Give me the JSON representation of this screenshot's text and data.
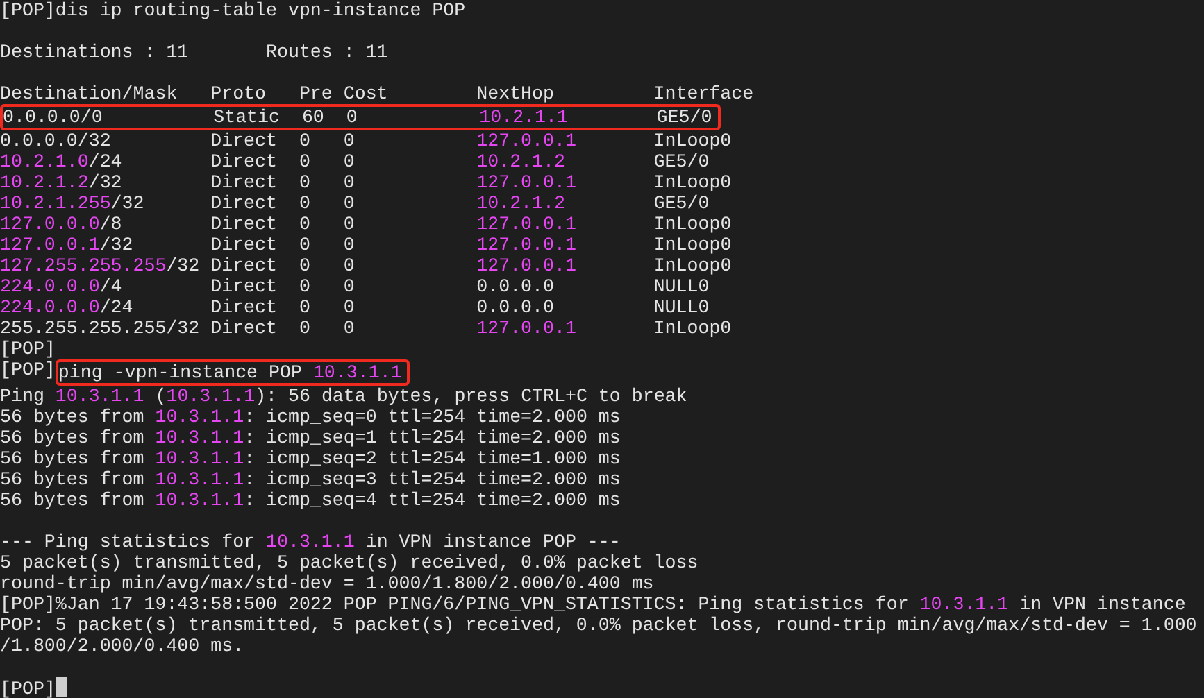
{
  "terminal": {
    "lines": [
      {
        "kind": "text",
        "parts": [
          {
            "kind": "plain",
            "text": "[POP]dis ip routing-table vpn-instance POP"
          }
        ]
      },
      {
        "kind": "blank"
      },
      {
        "kind": "text",
        "parts": [
          {
            "kind": "plain",
            "text": "Destinations : 11       Routes : 11"
          }
        ]
      },
      {
        "kind": "blank"
      },
      {
        "kind": "text",
        "parts": [
          {
            "kind": "plain",
            "text": "Destination/Mask   Proto   Pre Cost        NextHop         Interface"
          }
        ]
      },
      {
        "kind": "text",
        "parts": [
          {
            "kind": "highlight",
            "parts": [
              {
                "kind": "plain",
                "text": "0.0.0.0/0          Static  60  0           "
              },
              {
                "kind": "address",
                "text": "10.2.1.1"
              },
              {
                "kind": "plain",
                "text": "        GE5/0"
              }
            ]
          }
        ]
      },
      {
        "kind": "text",
        "parts": [
          {
            "kind": "plain",
            "text": "0.0.0.0/32         Direct  0   0           "
          },
          {
            "kind": "address",
            "text": "127.0.0.1"
          },
          {
            "kind": "plain",
            "text": "       InLoop0"
          }
        ]
      },
      {
        "kind": "text",
        "parts": [
          {
            "kind": "address",
            "text": "10.2.1.0"
          },
          {
            "kind": "plain",
            "text": "/24        Direct  0   0           "
          },
          {
            "kind": "address",
            "text": "10.2.1.2"
          },
          {
            "kind": "plain",
            "text": "        GE5/0"
          }
        ]
      },
      {
        "kind": "text",
        "parts": [
          {
            "kind": "address",
            "text": "10.2.1.2"
          },
          {
            "kind": "plain",
            "text": "/32        Direct  0   0           "
          },
          {
            "kind": "address",
            "text": "127.0.0.1"
          },
          {
            "kind": "plain",
            "text": "       InLoop0"
          }
        ]
      },
      {
        "kind": "text",
        "parts": [
          {
            "kind": "address",
            "text": "10.2.1.255"
          },
          {
            "kind": "plain",
            "text": "/32      Direct  0   0           "
          },
          {
            "kind": "address",
            "text": "10.2.1.2"
          },
          {
            "kind": "plain",
            "text": "        GE5/0"
          }
        ]
      },
      {
        "kind": "text",
        "parts": [
          {
            "kind": "address",
            "text": "127.0.0.0"
          },
          {
            "kind": "plain",
            "text": "/8        Direct  0   0           "
          },
          {
            "kind": "address",
            "text": "127.0.0.1"
          },
          {
            "kind": "plain",
            "text": "       InLoop0"
          }
        ]
      },
      {
        "kind": "text",
        "parts": [
          {
            "kind": "address",
            "text": "127.0.0.1"
          },
          {
            "kind": "plain",
            "text": "/32       Direct  0   0           "
          },
          {
            "kind": "address",
            "text": "127.0.0.1"
          },
          {
            "kind": "plain",
            "text": "       InLoop0"
          }
        ]
      },
      {
        "kind": "text",
        "parts": [
          {
            "kind": "address",
            "text": "127.255.255.255"
          },
          {
            "kind": "plain",
            "text": "/32 Direct  0   0           "
          },
          {
            "kind": "address",
            "text": "127.0.0.1"
          },
          {
            "kind": "plain",
            "text": "       InLoop0"
          }
        ]
      },
      {
        "kind": "text",
        "parts": [
          {
            "kind": "address",
            "text": "224.0.0.0"
          },
          {
            "kind": "plain",
            "text": "/4        Direct  0   0           0.0.0.0         NULL0"
          }
        ]
      },
      {
        "kind": "text",
        "parts": [
          {
            "kind": "address",
            "text": "224.0.0.0"
          },
          {
            "kind": "plain",
            "text": "/24       Direct  0   0           0.0.0.0         NULL0"
          }
        ]
      },
      {
        "kind": "text",
        "parts": [
          {
            "kind": "plain",
            "text": "255.255.255.255/32 Direct  0   0           "
          },
          {
            "kind": "address",
            "text": "127.0.0.1"
          },
          {
            "kind": "plain",
            "text": "       InLoop0"
          }
        ]
      },
      {
        "kind": "text",
        "parts": [
          {
            "kind": "plain",
            "text": "[POP]"
          }
        ]
      },
      {
        "kind": "text",
        "parts": [
          {
            "kind": "plain",
            "text": "[POP]"
          },
          {
            "kind": "highlight",
            "parts": [
              {
                "kind": "plain",
                "text": "ping -vpn-instance POP "
              },
              {
                "kind": "address",
                "text": "10.3.1.1"
              }
            ]
          }
        ]
      },
      {
        "kind": "text",
        "parts": [
          {
            "kind": "plain",
            "text": "Ping "
          },
          {
            "kind": "address",
            "text": "10.3.1.1"
          },
          {
            "kind": "plain",
            "text": " ("
          },
          {
            "kind": "address",
            "text": "10.3.1.1"
          },
          {
            "kind": "plain",
            "text": "): 56 data bytes, press CTRL+C to break"
          }
        ]
      },
      {
        "kind": "text",
        "parts": [
          {
            "kind": "plain",
            "text": "56 bytes from "
          },
          {
            "kind": "address",
            "text": "10.3.1.1"
          },
          {
            "kind": "plain",
            "text": ": icmp_seq=0 ttl=254 time=2.000 ms"
          }
        ]
      },
      {
        "kind": "text",
        "parts": [
          {
            "kind": "plain",
            "text": "56 bytes from "
          },
          {
            "kind": "address",
            "text": "10.3.1.1"
          },
          {
            "kind": "plain",
            "text": ": icmp_seq=1 ttl=254 time=2.000 ms"
          }
        ]
      },
      {
        "kind": "text",
        "parts": [
          {
            "kind": "plain",
            "text": "56 bytes from "
          },
          {
            "kind": "address",
            "text": "10.3.1.1"
          },
          {
            "kind": "plain",
            "text": ": icmp_seq=2 ttl=254 time=1.000 ms"
          }
        ]
      },
      {
        "kind": "text",
        "parts": [
          {
            "kind": "plain",
            "text": "56 bytes from "
          },
          {
            "kind": "address",
            "text": "10.3.1.1"
          },
          {
            "kind": "plain",
            "text": ": icmp_seq=3 ttl=254 time=2.000 ms"
          }
        ]
      },
      {
        "kind": "text",
        "parts": [
          {
            "kind": "plain",
            "text": "56 bytes from "
          },
          {
            "kind": "address",
            "text": "10.3.1.1"
          },
          {
            "kind": "plain",
            "text": ": icmp_seq=4 ttl=254 time=2.000 ms"
          }
        ]
      },
      {
        "kind": "blank"
      },
      {
        "kind": "text",
        "parts": [
          {
            "kind": "plain",
            "text": "--- Ping statistics for "
          },
          {
            "kind": "address",
            "text": "10.3.1.1"
          },
          {
            "kind": "plain",
            "text": " in VPN instance POP ---"
          }
        ]
      },
      {
        "kind": "text",
        "parts": [
          {
            "kind": "plain",
            "text": "5 packet(s) transmitted, 5 packet(s) received, 0.0% packet loss"
          }
        ]
      },
      {
        "kind": "text",
        "parts": [
          {
            "kind": "plain",
            "text": "round-trip min/avg/max/std-dev = 1.000/1.800/2.000/0.400 ms"
          }
        ]
      },
      {
        "kind": "text",
        "parts": [
          {
            "kind": "plain",
            "text": "[POP]%Jan 17 19:43:58:500 2022 POP PING/6/PING_VPN_STATISTICS: Ping statistics for "
          },
          {
            "kind": "address",
            "text": "10.3.1.1"
          },
          {
            "kind": "plain",
            "text": " in VPN instance"
          }
        ]
      },
      {
        "kind": "text",
        "parts": [
          {
            "kind": "plain",
            "text": "POP: 5 packet(s) transmitted, 5 packet(s) received, 0.0% packet loss, round-trip min/avg/max/std-dev = 1.000"
          }
        ]
      },
      {
        "kind": "text",
        "parts": [
          {
            "kind": "plain",
            "text": "/1.800/2.000/0.400 ms."
          }
        ]
      },
      {
        "kind": "blank"
      },
      {
        "kind": "text",
        "parts": [
          {
            "kind": "plain",
            "text": "[POP]"
          },
          {
            "kind": "cursor"
          }
        ]
      }
    ]
  }
}
